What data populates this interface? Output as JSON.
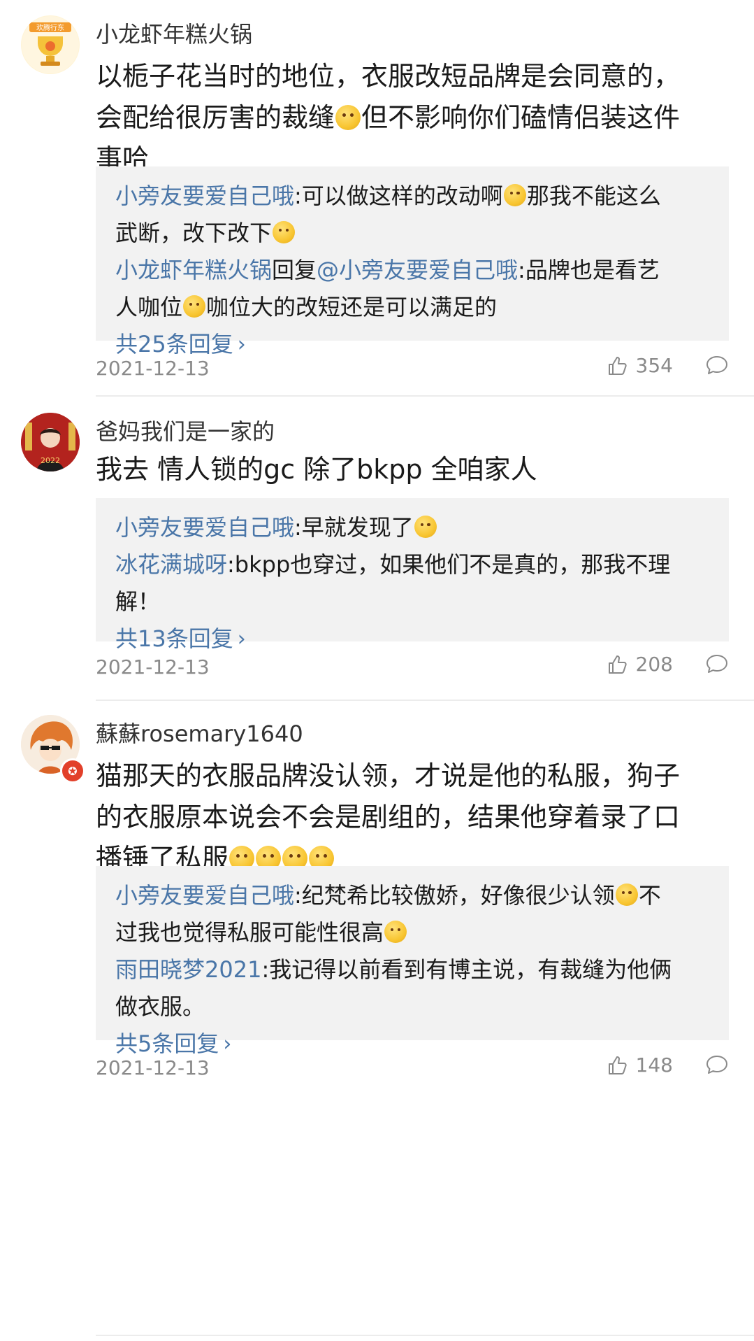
{
  "comments": [
    {
      "username": "小龙虾年糕火锅",
      "avatar_text": "欢腾行东",
      "content_lines": [
        "以栀子花当时的地位，衣服改短品牌是会同意的，",
        "会配给很厉害的裁缝",
        "但不影响你们磕情侣装这件",
        "事哈"
      ],
      "replies": [
        {
          "author": "小旁友要爱自己哦",
          "text_a": ":可以做这样的改动啊",
          "text_b": "那我不能这么",
          "text_c": "武断，改下改下"
        },
        {
          "author": "小龙虾年糕火锅",
          "reply_word": "回复",
          "mention": "@小旁友要爱自己哦",
          "text_a": ":品牌也是看艺",
          "text_b": "人咖位",
          "text_c": "咖位大的改短还是可以满足的"
        }
      ],
      "more_label": "共25条回复",
      "date": "2021-12-13",
      "likes": "354"
    },
    {
      "username": "爸妈我们是一家的",
      "avatar_text": "2022",
      "content_lines": [
        "我去 情人锁的gc 除了bkpp 全咱家人"
      ],
      "replies": [
        {
          "author": "小旁友要爱自己哦",
          "text_a": ":早就发现了"
        },
        {
          "author": "冰花满城呀",
          "text_a": ":bkpp也穿过，如果他们不是真的，那我不理",
          "text_b": "解！"
        }
      ],
      "more_label": "共13条回复",
      "date": "2021-12-13",
      "likes": "208"
    },
    {
      "username": "蘇蘇rosemary1640",
      "content_lines": [
        "猫那天的衣服品牌没认领，才说是他的私服，狗子",
        "的衣服原本说会不会是剧组的，结果他穿着录了口",
        "播锤了私服"
      ],
      "replies": [
        {
          "author": "小旁友要爱自己哦",
          "text_a": ":纪梵希比较傲娇，好像很少认领",
          "text_b": "不",
          "text_c": "过我也觉得私服可能性很高"
        },
        {
          "author": "雨田晓梦2021",
          "text_a": ":我记得以前看到有博主说，有裁缝为他俩",
          "text_b": "做衣服。"
        }
      ],
      "more_label": "共5条回复",
      "date": "2021-12-13",
      "likes": "148"
    }
  ],
  "icons": {
    "like": "thumbs-up-icon",
    "comment": "comment-bubble-icon",
    "emoji": "emoji-icon"
  },
  "colors": {
    "link": "#4a76a8",
    "reply_bg": "#f2f2f2",
    "meta": "#8a8a8a"
  }
}
